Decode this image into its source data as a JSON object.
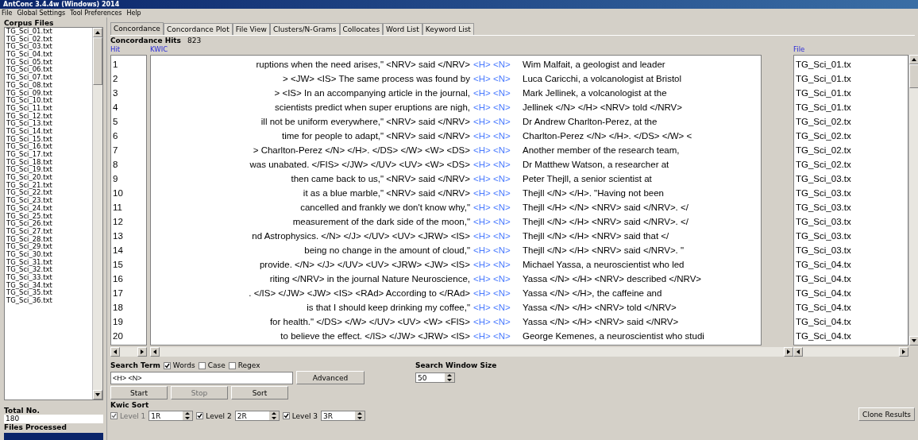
{
  "window": {
    "title": "AntConc 3.4.4w (Windows) 2014"
  },
  "menu": [
    "File",
    "Global Settings",
    "Tool Preferences",
    "Help"
  ],
  "corpus_files": {
    "title": "Corpus Files",
    "items": [
      "TG_Sci_01.txt",
      "TG_Sci_02.txt",
      "TG_Sci_03.txt",
      "TG_Sci_04.txt",
      "TG_Sci_05.txt",
      "TG_Sci_06.txt",
      "TG_Sci_07.txt",
      "TG_Sci_08.txt",
      "TG_Sci_09.txt",
      "TG_Sci_10.txt",
      "TG_Sci_11.txt",
      "TG_Sci_12.txt",
      "TG_Sci_13.txt",
      "TG_Sci_14.txt",
      "TG_Sci_15.txt",
      "TG_Sci_16.txt",
      "TG_Sci_17.txt",
      "TG_Sci_18.txt",
      "TG_Sci_19.txt",
      "TG_Sci_20.txt",
      "TG_Sci_21.txt",
      "TG_Sci_22.txt",
      "TG_Sci_23.txt",
      "TG_Sci_24.txt",
      "TG_Sci_25.txt",
      "TG_Sci_26.txt",
      "TG_Sci_27.txt",
      "TG_Sci_28.txt",
      "TG_Sci_29.txt",
      "TG_Sci_30.txt",
      "TG_Sci_31.txt",
      "TG_Sci_32.txt",
      "TG_Sci_33.txt",
      "TG_Sci_34.txt",
      "TG_Sci_35.txt",
      "TG_Sci_36.txt"
    ],
    "total_label": "Total No.",
    "total": "180",
    "processed": {
      "label": "Files Processed",
      "level": 1
    }
  },
  "tabs": [
    {
      "label": "Concordance",
      "selected": true
    },
    {
      "label": "Concordance Plot",
      "selected": false
    },
    {
      "label": "File View",
      "selected": false
    },
    {
      "label": "Clusters/N-Grams",
      "selected": false
    },
    {
      "label": "Collocates",
      "selected": false
    },
    {
      "label": "Word List",
      "selected": false
    },
    {
      "label": "Keyword List",
      "selected": false
    }
  ],
  "hits_label": "Concordance Hits",
  "hits": "823",
  "table": {
    "columns": [
      "Hit",
      "KWIC",
      "File"
    ],
    "rows": [
      {
        "hit": "1",
        "left": "ruptions when the need arises,\" <NRV> said </NRV>",
        "key": "<H> <N>",
        "right": "Wim Malfait, a geologist and leader",
        "file": "TG_Sci_01.tx"
      },
      {
        "hit": "2",
        "left": "> <JW> <IS> The same process was found by",
        "key": "<H> <N>",
        "right": "Luca Caricchi, a volcanologist at Bristol",
        "file": "TG_Sci_01.tx"
      },
      {
        "hit": "3",
        "left": "> <IS> In an accompanying article in the journal,",
        "key": "<H> <N>",
        "right": "Mark Jellinek, a volcanologist at the",
        "file": "TG_Sci_01.tx"
      },
      {
        "hit": "4",
        "left": "scientists predict when super eruptions are nigh,",
        "key": "<H> <N>",
        "right": "Jellinek </N> </H> <NRV> told </NRV>",
        "file": "TG_Sci_01.tx"
      },
      {
        "hit": "5",
        "left": "ill not be uniform everywhere,\" <NRV> said </NRV>",
        "key": "<H> <N>",
        "right": "Dr Andrew Charlton-Perez, at the",
        "file": "TG_Sci_02.tx"
      },
      {
        "hit": "6",
        "left": "time for people to adapt,\" <NRV> said </NRV>",
        "key": "<H> <N>",
        "right": "Charlton-Perez </N> </H>. </DS> </W> <",
        "file": "TG_Sci_02.tx"
      },
      {
        "hit": "7",
        "left": "> Charlton-Perez </N> </H>. </DS> </W> <W> <DS>",
        "key": "<H> <N>",
        "right": "Another member of the research team,",
        "file": "TG_Sci_02.tx"
      },
      {
        "hit": "8",
        "left": "was unabated. </FIS> </JW> </UV> <UV> <W> <DS>",
        "key": "<H> <N>",
        "right": "Dr Matthew Watson, a researcher at",
        "file": "TG_Sci_02.tx"
      },
      {
        "hit": "9",
        "left": "then came back to us,\" <NRV> said </NRV>",
        "key": "<H> <N>",
        "right": "Peter Thejll, a senior scientist at",
        "file": "TG_Sci_03.tx"
      },
      {
        "hit": "10",
        "left": "it as a blue marble,\" <NRV> said </NRV>",
        "key": "<H> <N>",
        "right": "Thejll </N> </H>. \"Having not been",
        "file": "TG_Sci_03.tx"
      },
      {
        "hit": "11",
        "left": "cancelled and frankly we don't know why,\"",
        "key": "<H> <N>",
        "right": "Thejll </H> </N> <NRV> said </NRV>. </",
        "file": "TG_Sci_03.tx"
      },
      {
        "hit": "12",
        "left": "measurement of the dark side of the moon,\"",
        "key": "<H> <N>",
        "right": "Thejll </N> </H> <NRV> said </NRV>. </",
        "file": "TG_Sci_03.tx"
      },
      {
        "hit": "13",
        "left": "nd Astrophysics. </N> </J> </UV> <UV> <JRW> <IS>",
        "key": "<H> <N>",
        "right": "Thejll </N> </H> <NRV> said that </",
        "file": "TG_Sci_03.tx"
      },
      {
        "hit": "14",
        "left": "being no change in the amount of cloud,\"",
        "key": "<H> <N>",
        "right": "Thejll </N> </H> <NRV> said </NRV>. \"",
        "file": "TG_Sci_03.tx"
      },
      {
        "hit": "15",
        "left": "provide. </N> </J> </UV> <UV> <JRW> <JW> <IS>",
        "key": "<H> <N>",
        "right": "Michael Yassa, a neuroscientist who led",
        "file": "TG_Sci_04.tx"
      },
      {
        "hit": "16",
        "left": "riting </NRV> in the journal Nature Neuroscience,",
        "key": "<H> <N>",
        "right": "Yassa </N> </H> <NRV> described </NRV>",
        "file": "TG_Sci_04.tx"
      },
      {
        "hit": "17",
        "left": ". </IS> </JW> <JW> <IS> <RAd> According to </RAd>",
        "key": "<H> <N>",
        "right": "Yassa </N> </H>, the caffeine and",
        "file": "TG_Sci_04.tx"
      },
      {
        "hit": "18",
        "left": "is that I should keep drinking my coffee,\"",
        "key": "<H> <N>",
        "right": "Yassa </N> </H> <NRV> told </NRV>",
        "file": "TG_Sci_04.tx"
      },
      {
        "hit": "19",
        "left": "for health.\" </DS> </W> </UV> <UV> <W> <FIS>",
        "key": "<H> <N>",
        "right": "Yassa </N> </H> <NRV> said </NRV>",
        "file": "TG_Sci_04.tx"
      },
      {
        "hit": "20",
        "left": "to believe the effect. </IS> </JW> <JRW> <IS>",
        "key": "<H> <N>",
        "right": "George Kemenes, a neuroscientist who studi",
        "file": "TG_Sci_04.tx"
      }
    ]
  },
  "search": {
    "label": "Search Term",
    "options": [
      {
        "label": "Words",
        "checked": true
      },
      {
        "label": "Case",
        "checked": false
      },
      {
        "label": "Regex",
        "checked": false
      }
    ],
    "value": "<H> <N>",
    "advanced": "Advanced"
  },
  "window_size": {
    "label": "Search Window Size",
    "value": "50"
  },
  "buttons": [
    {
      "label": "Start",
      "disabled": false
    },
    {
      "label": "Stop",
      "disabled": true
    },
    {
      "label": "Sort",
      "disabled": false
    }
  ],
  "kwic_sort": {
    "label": "Kwic Sort",
    "levels": [
      {
        "label": "Level 1",
        "value": "1R",
        "checked": true,
        "disabled": true
      },
      {
        "label": "Level 2",
        "value": "2R",
        "checked": true,
        "disabled": false
      },
      {
        "label": "Level 3",
        "value": "3R",
        "checked": true,
        "disabled": false
      }
    ]
  },
  "clone": "Clone Results"
}
